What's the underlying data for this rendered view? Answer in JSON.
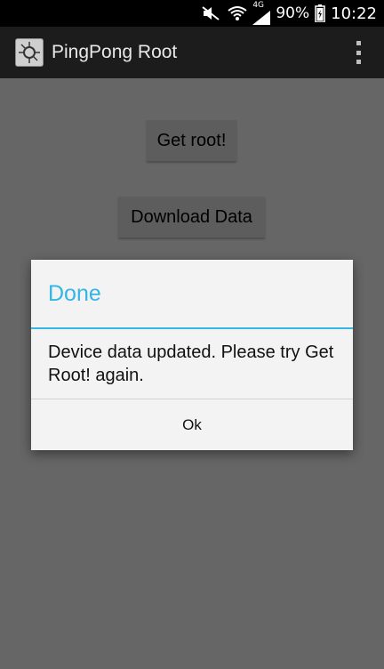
{
  "status_bar": {
    "battery_percent": "90%",
    "time": "10:22",
    "network_label": "4G",
    "icons": [
      "mute-icon",
      "wifi-icon",
      "signal-icon",
      "battery-icon"
    ]
  },
  "action_bar": {
    "title": "PingPong Root",
    "icons": [
      "app-icon",
      "overflow-menu-icon"
    ]
  },
  "main": {
    "get_root_label": "Get root!",
    "download_data_label": "Download Data"
  },
  "dialog": {
    "title": "Done",
    "message": "Device data updated. Please try Get Root! again.",
    "ok_label": "Ok"
  },
  "colors": {
    "accent": "#33b5e5",
    "scrim_background": "#666666",
    "action_bar": "#1c1c1c",
    "dialog_background": "#f3f3f3"
  }
}
